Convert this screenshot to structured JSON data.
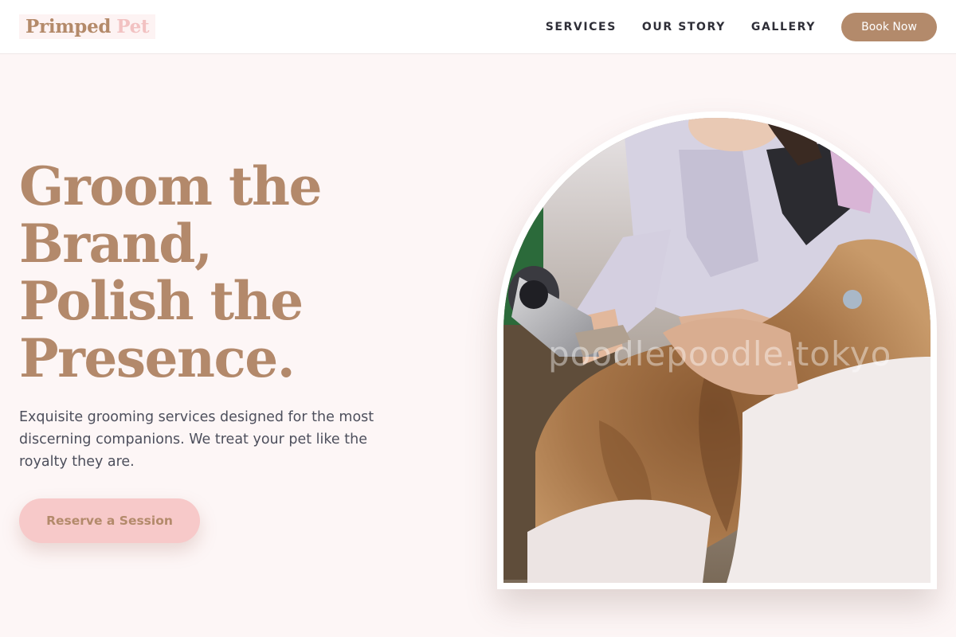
{
  "brand": {
    "name_part1": "Primped",
    "name_part2": "Pet"
  },
  "nav": {
    "links": [
      {
        "label": "SERVICES"
      },
      {
        "label": "OUR STORY"
      },
      {
        "label": "GALLERY"
      }
    ],
    "book_button": "Book Now"
  },
  "hero": {
    "title_lines": [
      "Groom the",
      "Brand,",
      "Polish the",
      "Presence."
    ],
    "description": "Exquisite grooming services designed for the most discerning companions. We treat your pet like the royalty they are.",
    "cta_label": "Reserve a Session",
    "image_watermark": "poodlepoodle.tokyo"
  },
  "colors": {
    "accent": "#b3896b",
    "pink": "#f7c9c9",
    "background": "#fdf6f6"
  }
}
